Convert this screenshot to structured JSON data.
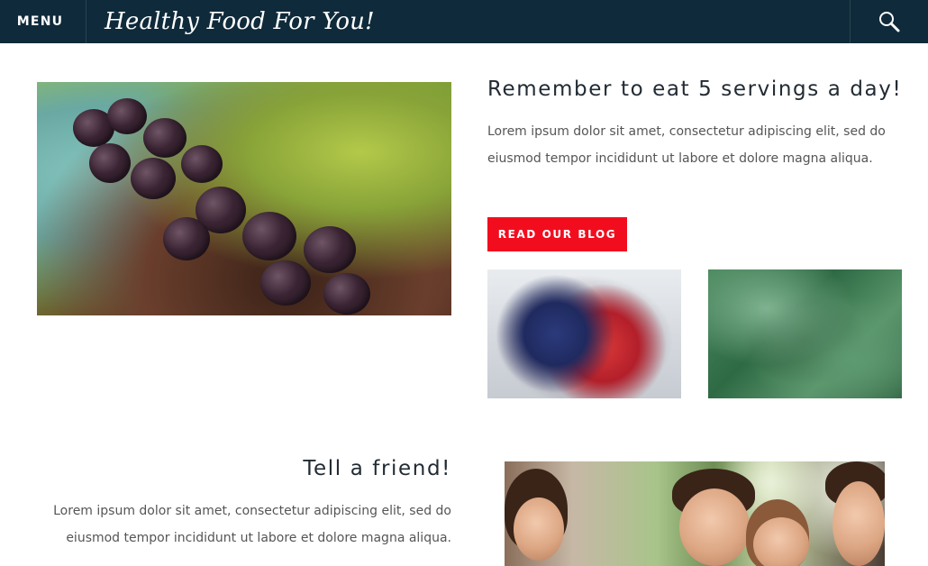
{
  "header": {
    "menu_label": "MENU",
    "site_title": "Healthy Food For You!",
    "background_color": "#0f2a3a",
    "search_icon": "search-icon"
  },
  "section1": {
    "heading": "Remember to eat 5 servings a day!",
    "body": "Lorem ipsum dolor sit amet, consectetur adipiscing elit, sed do eiusmod tempor incididunt ut labore et dolore magna aliqua.",
    "button_label": "READ OUR BLOG",
    "button_color": "#f20d1e",
    "images": [
      "blackberries-photo",
      "berries-mix-photo",
      "kale-photo"
    ]
  },
  "section2": {
    "heading": "Tell a friend!",
    "body": "Lorem ipsum dolor sit amet, consectetur adipiscing elit, sed do eiusmod tempor incididunt ut labore et dolore magna aliqua.",
    "images": [
      "friends-photo"
    ]
  }
}
